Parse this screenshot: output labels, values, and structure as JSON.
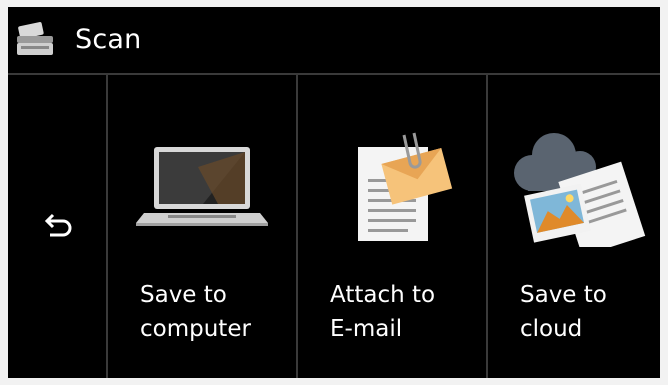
{
  "header": {
    "title": "Scan",
    "icon": "scanner-icon"
  },
  "back": {
    "icon": "return-arrow-icon"
  },
  "options": [
    {
      "id": "save-to-computer",
      "label": "Save to\ncomputer",
      "icon": "laptop-icon"
    },
    {
      "id": "attach-to-email",
      "label": "Attach to\nE-mail",
      "icon": "document-envelope-icon"
    },
    {
      "id": "save-to-cloud",
      "label": "Save to\ncloud",
      "icon": "cloud-photo-icon"
    }
  ],
  "colors": {
    "background": "#000000",
    "divider": "#3a3a3a",
    "text": "#ffffff"
  }
}
